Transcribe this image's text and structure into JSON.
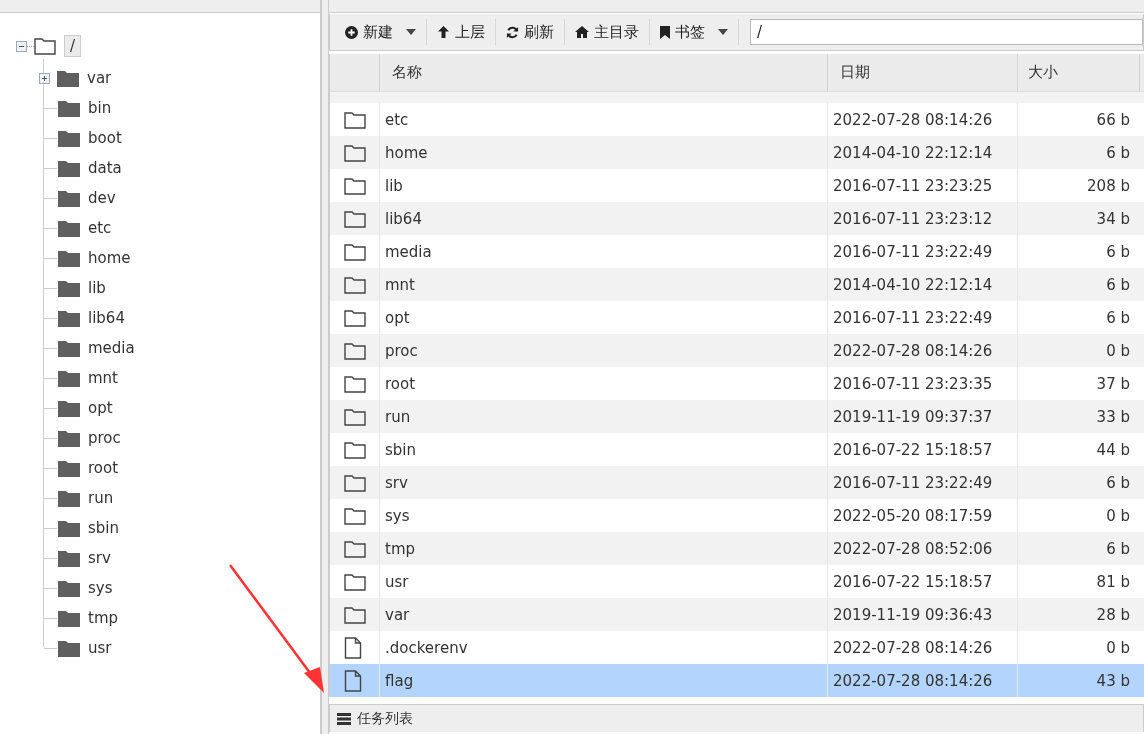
{
  "tree": {
    "label": "/",
    "expanded": true,
    "selected": true,
    "children": [
      {
        "label": "var",
        "expandable": true
      },
      {
        "label": "bin",
        "expandable": false
      },
      {
        "label": "boot",
        "expandable": false
      },
      {
        "label": "data",
        "expandable": false
      },
      {
        "label": "dev",
        "expandable": false
      },
      {
        "label": "etc",
        "expandable": false
      },
      {
        "label": "home",
        "expandable": false
      },
      {
        "label": "lib",
        "expandable": false
      },
      {
        "label": "lib64",
        "expandable": false
      },
      {
        "label": "media",
        "expandable": false
      },
      {
        "label": "mnt",
        "expandable": false
      },
      {
        "label": "opt",
        "expandable": false
      },
      {
        "label": "proc",
        "expandable": false
      },
      {
        "label": "root",
        "expandable": false
      },
      {
        "label": "run",
        "expandable": false
      },
      {
        "label": "sbin",
        "expandable": false
      },
      {
        "label": "srv",
        "expandable": false
      },
      {
        "label": "sys",
        "expandable": false
      },
      {
        "label": "tmp",
        "expandable": false
      },
      {
        "label": "usr",
        "expandable": false
      }
    ]
  },
  "toolbar": {
    "buttons": [
      {
        "kind": "new",
        "label": "新建",
        "dropdown": true
      },
      {
        "kind": "up",
        "label": "上层",
        "dropdown": false
      },
      {
        "kind": "refresh",
        "label": "刷新",
        "dropdown": false
      },
      {
        "kind": "home",
        "label": "主目录",
        "dropdown": false
      },
      {
        "kind": "bookmark",
        "label": "书签",
        "dropdown": true
      }
    ],
    "path": "/"
  },
  "table": {
    "columns": [
      "名称",
      "日期",
      "大小"
    ],
    "rows": [
      {
        "kind": "folder",
        "name": "etc",
        "date": "2022-07-28 08:14:26",
        "size": "66 b",
        "selected": false
      },
      {
        "kind": "folder",
        "name": "home",
        "date": "2014-04-10 22:12:14",
        "size": "6 b",
        "selected": false
      },
      {
        "kind": "folder",
        "name": "lib",
        "date": "2016-07-11 23:23:25",
        "size": "208 b",
        "selected": false
      },
      {
        "kind": "folder",
        "name": "lib64",
        "date": "2016-07-11 23:23:12",
        "size": "34 b",
        "selected": false
      },
      {
        "kind": "folder",
        "name": "media",
        "date": "2016-07-11 23:22:49",
        "size": "6 b",
        "selected": false
      },
      {
        "kind": "folder",
        "name": "mnt",
        "date": "2014-04-10 22:12:14",
        "size": "6 b",
        "selected": false
      },
      {
        "kind": "folder",
        "name": "opt",
        "date": "2016-07-11 23:22:49",
        "size": "6 b",
        "selected": false
      },
      {
        "kind": "folder",
        "name": "proc",
        "date": "2022-07-28 08:14:26",
        "size": "0 b",
        "selected": false
      },
      {
        "kind": "folder",
        "name": "root",
        "date": "2016-07-11 23:23:35",
        "size": "37 b",
        "selected": false
      },
      {
        "kind": "folder",
        "name": "run",
        "date": "2019-11-19 09:37:37",
        "size": "33 b",
        "selected": false
      },
      {
        "kind": "folder",
        "name": "sbin",
        "date": "2016-07-22 15:18:57",
        "size": "44 b",
        "selected": false
      },
      {
        "kind": "folder",
        "name": "srv",
        "date": "2016-07-11 23:22:49",
        "size": "6 b",
        "selected": false
      },
      {
        "kind": "folder",
        "name": "sys",
        "date": "2022-05-20 08:17:59",
        "size": "0 b",
        "selected": false
      },
      {
        "kind": "folder",
        "name": "tmp",
        "date": "2022-07-28 08:52:06",
        "size": "6 b",
        "selected": false
      },
      {
        "kind": "folder",
        "name": "usr",
        "date": "2016-07-22 15:18:57",
        "size": "81 b",
        "selected": false
      },
      {
        "kind": "folder",
        "name": "var",
        "date": "2019-11-19 09:36:43",
        "size": "28 b",
        "selected": false
      },
      {
        "kind": "file",
        "name": ".dockerenv",
        "date": "2022-07-28 08:14:26",
        "size": "0 b",
        "selected": false
      },
      {
        "kind": "file",
        "name": "flag",
        "date": "2022-07-28 08:14:26",
        "size": "43 b",
        "selected": true
      }
    ]
  },
  "footer": {
    "title": "任务列表"
  },
  "annotations": [
    {
      "kind": "arrow"
    }
  ]
}
